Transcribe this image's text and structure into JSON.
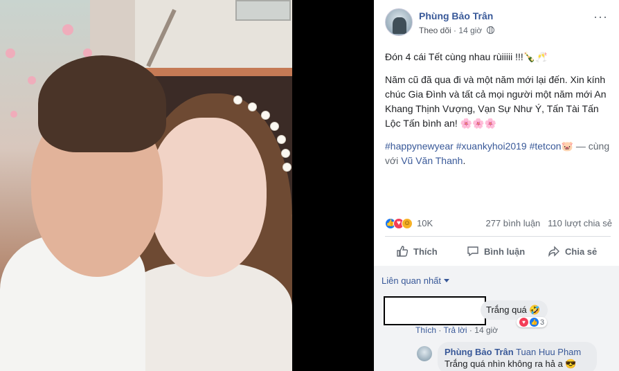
{
  "post": {
    "author": "Phùng Bảo Trân",
    "follow": "Theo dõi",
    "time": "14 giờ",
    "line1": "Đón 4 cái Tết cùng nhau rùiiiii !!!🍾🥂",
    "line2": "Năm cũ đã qua đi và một năm mới lại đến. Xin kính chúc Gia Đình và tất cả mọi người một năm mới An Khang Thịnh Vượng, Vạn Sự Như Ý, Tấn Tài Tấn Lộc Tấn bình an! 🌸🌸🌸",
    "hashtags": "#happynewyear #xuankyhoi2019 #tetcon🐷",
    "with_text": " — cùng với ",
    "with_name": "Vũ Văn Thanh",
    "period": ".",
    "reaction_count": "10K",
    "comments_count": "277 bình luận",
    "shares_count": "110 lượt chia sẻ"
  },
  "actions": {
    "like": "Thích",
    "comment": "Bình luận",
    "share": "Chia sẻ"
  },
  "icons": {
    "like": "thumbs-up-icon",
    "comment": "speech-bubble-icon",
    "share": "share-arrow-icon",
    "privacy": "globe-icon",
    "more": "more-horizontal-icon"
  },
  "comments": {
    "sort_label": "Liên quan nhất",
    "c1_text": "Trắng quá 🤣",
    "c1_react_count": "3",
    "c1_like": "Thích",
    "c1_reply": "Trả lời",
    "c1_time": "14 giờ",
    "reply_author": "Phùng Bảo Trân",
    "reply_tag": "Tuan Huu Pham",
    "reply_text": "Trắng quá nhìn không ra hả a 😎"
  },
  "colors": {
    "link": "#385898",
    "secondary": "#606770",
    "bubble": "#e9ebee"
  }
}
